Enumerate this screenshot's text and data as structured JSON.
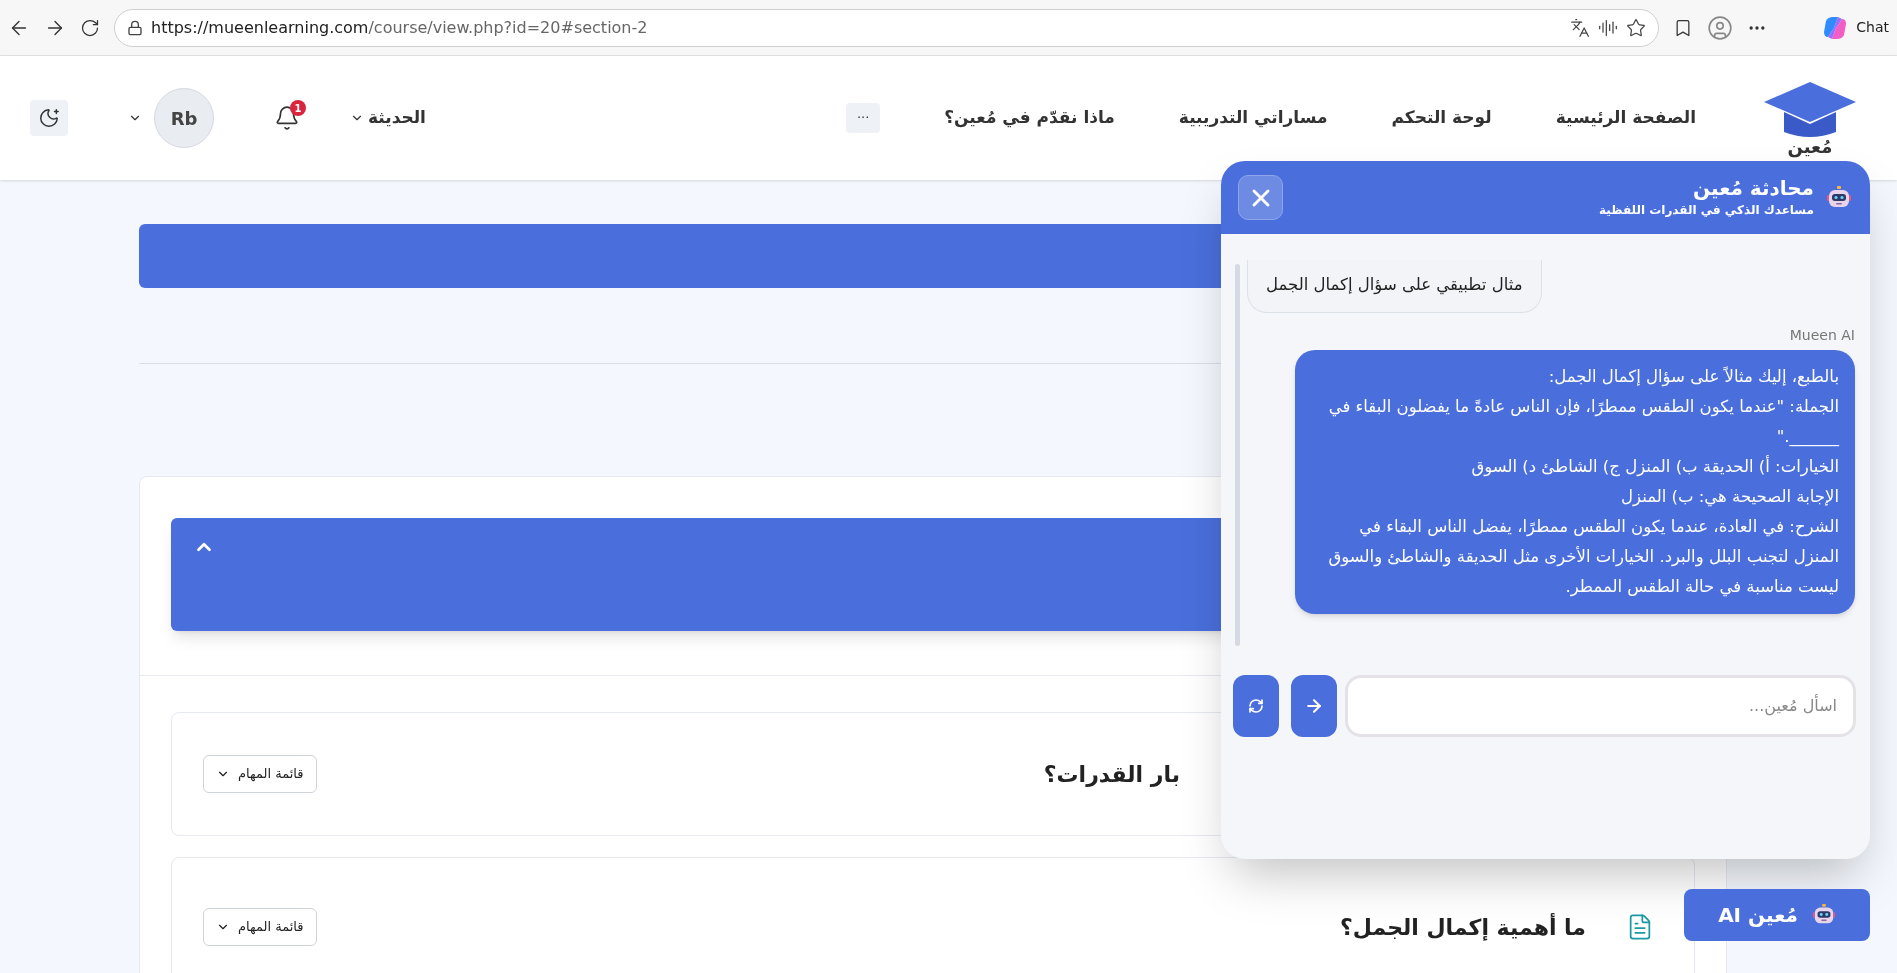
{
  "browser": {
    "url_host": "https://mueenlearning.com",
    "url_path": "/course/view.php?id=20#section-2",
    "chat_label": "Chat"
  },
  "nav": {
    "logo_text": "مُعين",
    "links": [
      {
        "label": "الصفحة الرئيسية"
      },
      {
        "label": "لوحة التحكم"
      },
      {
        "label": "مساراتي التدريبية"
      },
      {
        "label": "ماذا نقدّم في مُعين؟"
      }
    ],
    "more": "···",
    "dropdown": "الحديثة",
    "notifications": "1",
    "avatar": "Rb"
  },
  "cards": [
    {
      "title": "بار القدرات؟",
      "menu": "قائمة المهام",
      "has_file_icon": false
    },
    {
      "title": "ما أهمية إكمال الجمل؟",
      "menu": "قائمة المهام",
      "has_file_icon": true
    }
  ],
  "chat": {
    "title": "محادثة مُعين",
    "subtitle": "مساعدك الذكي في القدرات اللفظية",
    "messages": [
      {
        "kind": "user",
        "lines": [
          "مثال تطبيقي على سؤال إكمال الجمل"
        ]
      },
      {
        "kind": "bot",
        "sender": "Mueen AI",
        "lines": [
          "بالطبع، إليك مثالاً على سؤال إكمال الجمل:",
          "الجملة: \"عندما يكون الطقس ممطرًا، فإن الناس عادةً ما يفضلون البقاء في ______.\"",
          "الخيارات: أ) الحديقة ب) المنزل ج) الشاطئ د) السوق",
          "الإجابة الصحيحة هي: ب) المنزل",
          "الشرح: في العادة، عندما يكون الطقس ممطرًا، يفضل الناس البقاء في المنزل لتجنب البلل والبرد. الخيارات الأخرى مثل الحديقة والشاطئ والسوق ليست مناسبة في حالة الطقس الممطر."
        ]
      }
    ],
    "input_placeholder": "اسأل مُعين..."
  },
  "launcher": {
    "label": "مُعين AI"
  }
}
